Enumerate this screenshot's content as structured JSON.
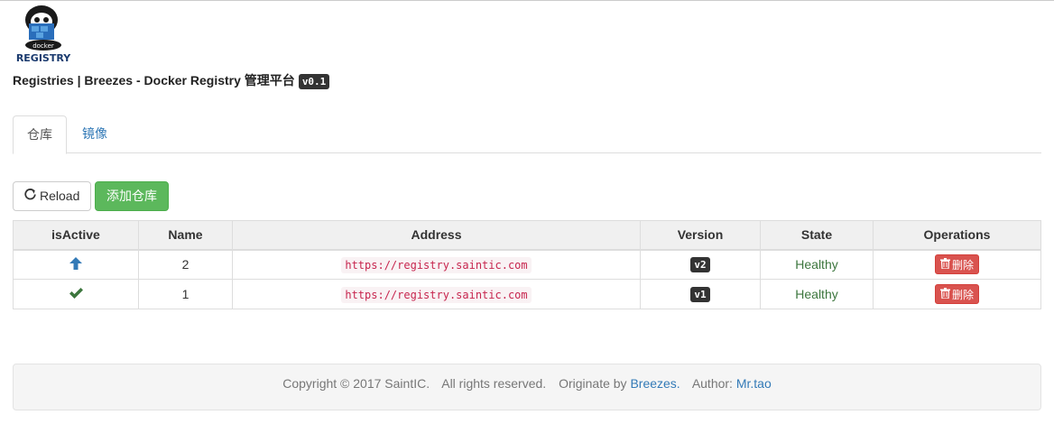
{
  "header": {
    "logo_text": [
      "docker",
      "REGISTRY"
    ],
    "title": "Registries | Breezes - Docker Registry 管理平台",
    "version": "v0.1"
  },
  "tabs": [
    {
      "label": "仓库",
      "active": true
    },
    {
      "label": "镜像",
      "active": false
    }
  ],
  "toolbar": {
    "reload_icon": "refresh-icon",
    "reload_label": "Reload",
    "add_label": "添加仓库"
  },
  "table": {
    "columns": [
      "isActive",
      "Name",
      "Address",
      "Version",
      "State",
      "Operations"
    ],
    "rows": [
      {
        "active_icon": "arrow-up-icon",
        "name": "2",
        "address": "https://registry.saintic.com",
        "version": "v2",
        "state": "Healthy",
        "op_label": "删除"
      },
      {
        "active_icon": "check-icon",
        "name": "1",
        "address": "https://registry.saintic.com",
        "version": "v1",
        "state": "Healthy",
        "op_label": "删除"
      }
    ]
  },
  "footer": {
    "copyright": "Copyright © 2017 SaintIC.",
    "rights": "All rights reserved.",
    "originate_prefix": "Originate by",
    "originate_link": "Breezes.",
    "author_prefix": "Author:",
    "author_link": "Mr.tao"
  },
  "colors": {
    "link": "#337ab7",
    "success": "#5cb85c",
    "danger": "#d9534f",
    "healthy": "#3c763d",
    "arrow": "#337ab7"
  }
}
